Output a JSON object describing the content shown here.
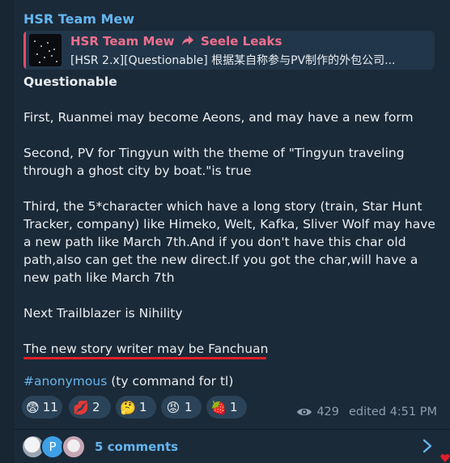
{
  "message": {
    "sender": "HSR Team Mew",
    "reply": {
      "from": "HSR Team Mew",
      "via": "Seele Leaks",
      "preview": "[HSR 2.x][Questionable] 根据某自称参与PV制作的外包公司..."
    },
    "title": "Questionable",
    "paragraphs": [
      "First, Ruanmei may become Aeons, and may have a new form",
      "Second, PV for Tingyun with the theme of \"Tingyun traveling through a ghost city by boat.\"is true",
      "Third, the 5*character which have a long story (train, Star Hunt Tracker, company) like Himeko, Welt, Kafka, Sliver Wolf may have a new path like March 7th.And if you don't have this char old path,also can get the new direct.If you got the char,will have a new path like March 7th",
      "Next Trailblazer is Nihility",
      "The new story writer may be Fanchuan"
    ],
    "hashtag": "#anonymous",
    "hashtag_note": "(ty command for tl)",
    "reactions": [
      {
        "emoji": "😨",
        "count": "11"
      },
      {
        "emoji": "💋",
        "count": "2"
      },
      {
        "emoji": "🤔",
        "count": "1"
      },
      {
        "emoji": "😡",
        "count": "1"
      },
      {
        "emoji": "🍓",
        "count": "1"
      }
    ],
    "views": "429",
    "edited": "edited 4:51 PM"
  },
  "comments": {
    "label": "5 comments",
    "avatar_letter": "P"
  },
  "colors": {
    "background": "#182533",
    "bubble": "#1b2a38",
    "link": "#64b5ef",
    "reply_accent": "#e24b6b",
    "annotation_underline": "#e0202a"
  }
}
